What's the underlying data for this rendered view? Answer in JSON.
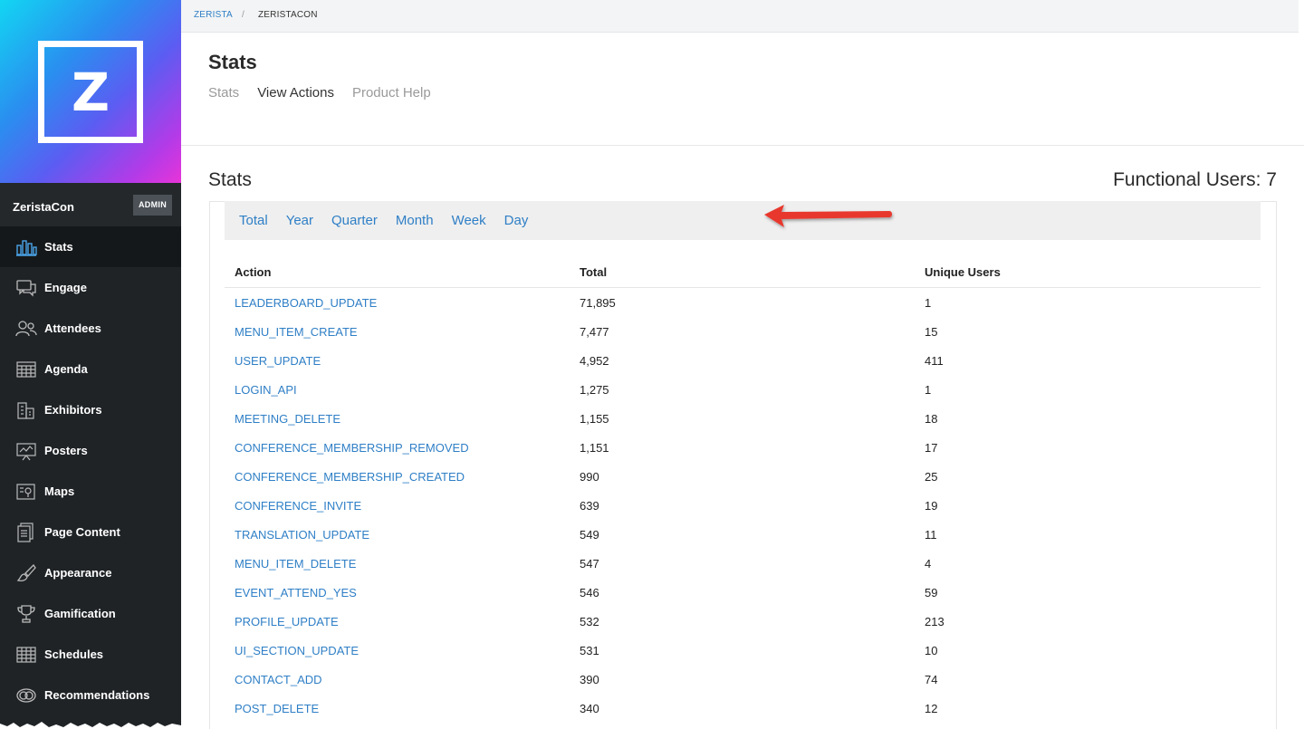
{
  "brand": {
    "logo_letter": "Z"
  },
  "org": {
    "name": "ZeristaCon",
    "badge": "ADMIN"
  },
  "sidebar": {
    "items": [
      {
        "label": "Stats",
        "icon": "bar-chart-icon",
        "active": true
      },
      {
        "label": "Engage",
        "icon": "chat-icon",
        "active": false
      },
      {
        "label": "Attendees",
        "icon": "people-icon",
        "active": false
      },
      {
        "label": "Agenda",
        "icon": "calendar-grid-icon",
        "active": false
      },
      {
        "label": "Exhibitors",
        "icon": "building-icon",
        "active": false
      },
      {
        "label": "Posters",
        "icon": "presentation-icon",
        "active": false
      },
      {
        "label": "Maps",
        "icon": "map-icon",
        "active": false
      },
      {
        "label": "Page Content",
        "icon": "document-icon",
        "active": false
      },
      {
        "label": "Appearance",
        "icon": "paintbrush-icon",
        "active": false
      },
      {
        "label": "Gamification",
        "icon": "trophy-icon",
        "active": false
      },
      {
        "label": "Schedules",
        "icon": "table-grid-icon",
        "active": false
      },
      {
        "label": "Recommendations",
        "icon": "recommend-icon",
        "active": false
      }
    ]
  },
  "breadcrumb": {
    "root": "ZERISTA",
    "separator": "/",
    "current": "ZERISTACON"
  },
  "header": {
    "title": "Stats",
    "tabs": {
      "stats": "Stats",
      "view_actions": "View Actions",
      "product_help": "Product Help"
    }
  },
  "stats": {
    "title": "Stats",
    "functional_users": "Functional Users: 7",
    "filters": {
      "total": "Total",
      "year": "Year",
      "quarter": "Quarter",
      "month": "Month",
      "week": "Week",
      "day": "Day"
    }
  },
  "table": {
    "headers": {
      "action": "Action",
      "total": "Total",
      "unique": "Unique Users"
    },
    "rows": [
      {
        "action": "LEADERBOARD_UPDATE",
        "total": "71,895",
        "unique": "1"
      },
      {
        "action": "MENU_ITEM_CREATE",
        "total": "7,477",
        "unique": "15"
      },
      {
        "action": "USER_UPDATE",
        "total": "4,952",
        "unique": "411"
      },
      {
        "action": "LOGIN_API",
        "total": "1,275",
        "unique": "1"
      },
      {
        "action": "MEETING_DELETE",
        "total": "1,155",
        "unique": "18"
      },
      {
        "action": "CONFERENCE_MEMBERSHIP_REMOVED",
        "total": "1,151",
        "unique": "17"
      },
      {
        "action": "CONFERENCE_MEMBERSHIP_CREATED",
        "total": "990",
        "unique": "25"
      },
      {
        "action": "CONFERENCE_INVITE",
        "total": "639",
        "unique": "19"
      },
      {
        "action": "TRANSLATION_UPDATE",
        "total": "549",
        "unique": "11"
      },
      {
        "action": "MENU_ITEM_DELETE",
        "total": "547",
        "unique": "4"
      },
      {
        "action": "EVENT_ATTEND_YES",
        "total": "546",
        "unique": "59"
      },
      {
        "action": "PROFILE_UPDATE",
        "total": "532",
        "unique": "213"
      },
      {
        "action": "UI_SECTION_UPDATE",
        "total": "531",
        "unique": "10"
      },
      {
        "action": "CONTACT_ADD",
        "total": "390",
        "unique": "74"
      },
      {
        "action": "POST_DELETE",
        "total": "340",
        "unique": "12"
      }
    ]
  },
  "colors": {
    "link": "#2f7fc6",
    "sidebar_bg": "#1f2326",
    "annotation_arrow": "#e8392e"
  }
}
